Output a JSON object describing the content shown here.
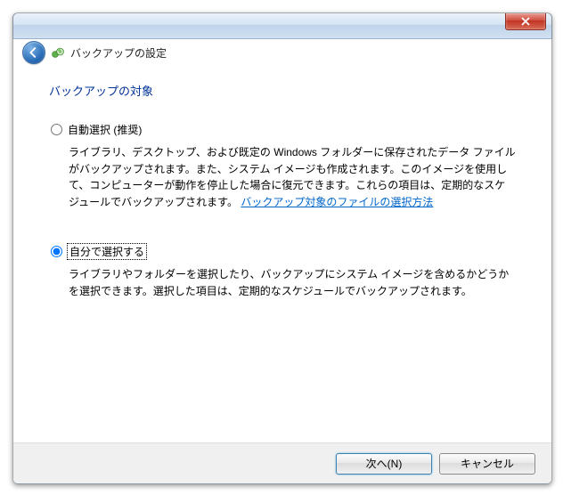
{
  "header": {
    "title": "バックアップの設定"
  },
  "section_title": "バックアップの対象",
  "options": {
    "auto": {
      "label": "自動選択 (推奨)",
      "desc_before_link": "ライブラリ、デスクトップ、および既定の Windows フォルダーに保存されたデータ ファイルがバックアップされます。また、システム イメージも作成されます。このイメージを使用して、コンピューターが動作を停止した場合に復元できます。これらの項目は、定期的なスケジュールでバックアップされます。",
      "link_text": "バックアップ対象のファイルの選択方法"
    },
    "manual": {
      "label": "自分で選択する",
      "desc": "ライブラリやフォルダーを選択したり、バックアップにシステム イメージを含めるかどうかを選択できます。選択した項目は、定期的なスケジュールでバックアップされます。"
    }
  },
  "footer": {
    "next": "次へ(N)",
    "cancel": "キャンセル"
  }
}
